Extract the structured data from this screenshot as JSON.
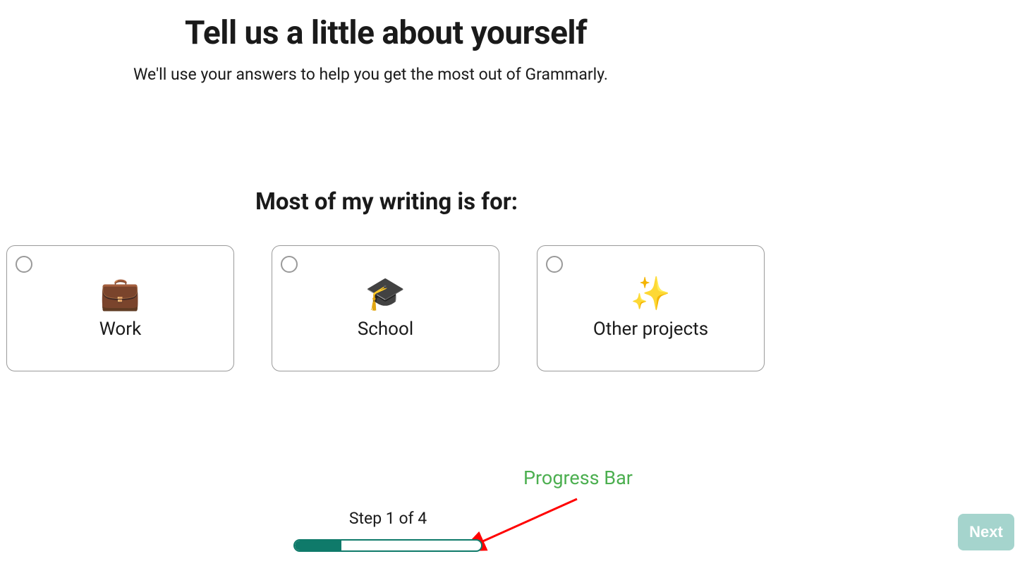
{
  "header": {
    "title": "Tell us a little about yourself",
    "subtitle": "We'll use your answers to help you get the most out of Grammarly."
  },
  "question": {
    "prompt": "Most of my writing is for:",
    "options": [
      {
        "icon": "💼",
        "label": "Work"
      },
      {
        "icon": "🎓",
        "label": "School"
      },
      {
        "icon": "✨",
        "label": "Other projects"
      }
    ]
  },
  "progress": {
    "step_text": "Step 1 of 4",
    "current_step": 1,
    "total_steps": 4,
    "percent": 25
  },
  "annotation": {
    "label": "Progress Bar"
  },
  "footer": {
    "next_label": "Next"
  },
  "colors": {
    "accent": "#0f7a6a",
    "next_button_bg": "#a5d4cd",
    "annotation": "#4caf50",
    "arrow": "#ff0000"
  }
}
